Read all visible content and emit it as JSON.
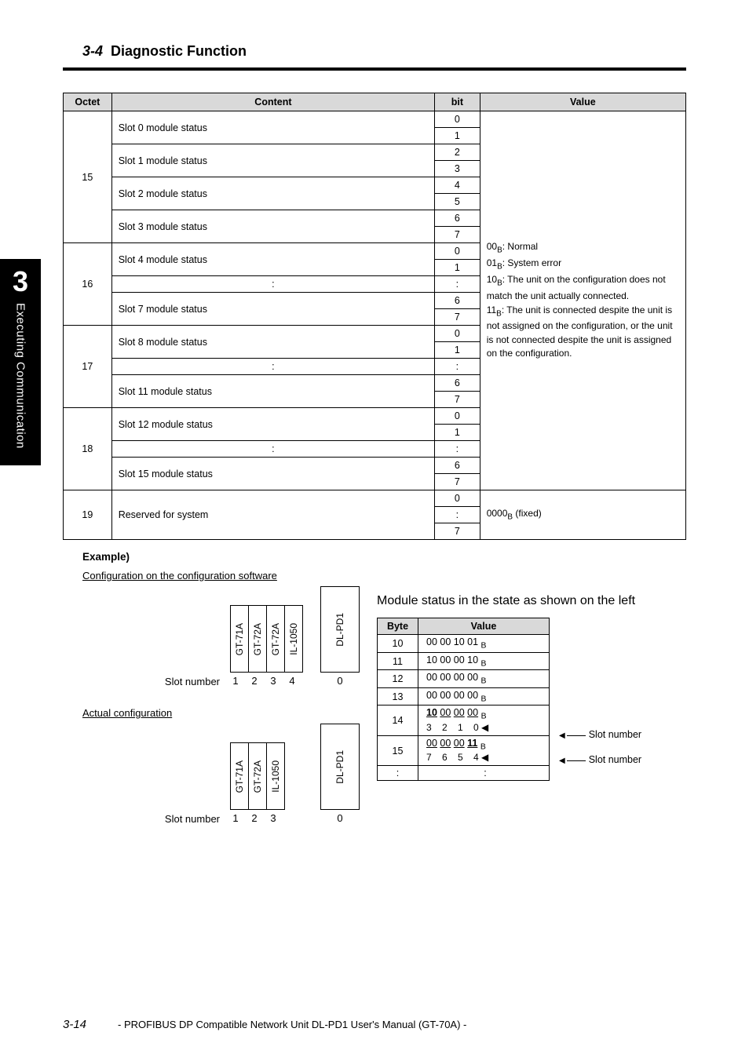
{
  "header": {
    "section_number": "3-4",
    "section_title": "Diagnostic Function"
  },
  "side_tab": {
    "chapter_num": "3",
    "chapter_text": "Executing Communication"
  },
  "table": {
    "headers": {
      "octet": "Octet",
      "content": "Content",
      "bit": "bit",
      "value": "Value"
    },
    "value_text": {
      "line1_code": "00",
      "line1_sub": "B",
      "line1_rest": ": Normal",
      "line2_code": "01",
      "line2_sub": "B",
      "line2_rest": ": System error",
      "line3_code": "10",
      "line3_sub": "B",
      "line3_rest": ": The unit on the configuration does not match the unit actually connected.",
      "line4_code": "11",
      "line4_sub": "B",
      "line4_rest": ": The unit is connected despite the unit is not assigned on the configuration, or the unit is not connected despite the unit is assigned on the configuration."
    },
    "octet19_value": {
      "code": "0000",
      "sub": "B",
      "rest": " (fixed)"
    },
    "rows": [
      {
        "octet": "15",
        "items": [
          {
            "content": "Slot 0 module status",
            "bits": [
              "0",
              "1"
            ]
          },
          {
            "content": "Slot 1 module status",
            "bits": [
              "2",
              "3"
            ]
          },
          {
            "content": "Slot 2 module status",
            "bits": [
              "4",
              "5"
            ]
          },
          {
            "content": "Slot 3 module status",
            "bits": [
              "6",
              "7"
            ]
          }
        ]
      },
      {
        "octet": "16",
        "items": [
          {
            "content": "Slot 4 module status",
            "bits": [
              "0",
              "1"
            ]
          },
          {
            "content": ":",
            "bits": [
              ":"
            ],
            "center": true
          },
          {
            "content": "Slot 7 module status",
            "bits": [
              "6",
              "7"
            ]
          }
        ]
      },
      {
        "octet": "17",
        "items": [
          {
            "content": "Slot 8 module status",
            "bits": [
              "0",
              "1"
            ]
          },
          {
            "content": ":",
            "bits": [
              ":"
            ],
            "center": true
          },
          {
            "content": "Slot 11 module status",
            "bits": [
              "6",
              "7"
            ]
          }
        ]
      },
      {
        "octet": "18",
        "items": [
          {
            "content": "Slot 12 module status",
            "bits": [
              "0",
              "1"
            ]
          },
          {
            "content": ":",
            "bits": [
              ":"
            ],
            "center": true
          },
          {
            "content": "Slot 15 module status",
            "bits": [
              "6",
              "7"
            ]
          }
        ]
      },
      {
        "octet": "19",
        "items": [
          {
            "content": "Reserved for system",
            "bits": [
              "0",
              ":",
              "7"
            ],
            "single": true
          }
        ]
      }
    ]
  },
  "example": {
    "label": "Example)",
    "config_label": "Configuration on the configuration software",
    "actual_label": "Actual configuration",
    "slot_number_label": "Slot number",
    "config_modules": [
      "GT-71A",
      "GT-72A",
      "GT-72A",
      "IL-1050",
      "",
      "DL-PD1"
    ],
    "config_slots": [
      "1",
      "2",
      "3",
      "4",
      "",
      "0"
    ],
    "actual_modules": [
      "GT-71A",
      "GT-72A",
      "IL-1050",
      "",
      "",
      "DL-PD1"
    ],
    "actual_slots": [
      "1",
      "2",
      "3",
      "",
      "",
      "0"
    ],
    "right_desc": "Module status in the state as shown on the left",
    "bytes_headers": {
      "byte": "Byte",
      "value": "Value"
    },
    "bytes_rows": [
      {
        "byte": "10",
        "value_html": "00 00 10 01 <sub>B</sub>"
      },
      {
        "byte": "11",
        "value_html": "10 00 00 10 <sub>B</sub>"
      },
      {
        "byte": "12",
        "value_html": "00 00 00 00 <sub>B</sub>"
      },
      {
        "byte": "13",
        "value_html": "00 00 00 00 <sub>B</sub>"
      },
      {
        "byte": "14",
        "value_html": "<span class='ul bd'>10</span> <span class='ul'>00</span> <span class='ul'>00</span> <span class='ul'>00</span> <sub>B</sub>",
        "row2": " 3&nbsp;&nbsp;&nbsp;&nbsp;2&nbsp;&nbsp;&nbsp;&nbsp;1&nbsp;&nbsp;&nbsp;&nbsp;0",
        "arrow": "Slot number"
      },
      {
        "byte": "15",
        "value_html": "<span class='ul'>00</span> <span class='ul'>00</span> <span class='ul'>00</span> <span class='ul bd'>11</span> <sub>B</sub>",
        "row2": " 7&nbsp;&nbsp;&nbsp;&nbsp;6&nbsp;&nbsp;&nbsp;&nbsp;5&nbsp;&nbsp;&nbsp;&nbsp;4",
        "arrow": "Slot number"
      },
      {
        "byte": ":",
        "value_html": ":"
      }
    ],
    "arrow_label": "Slot number"
  },
  "footer": {
    "page": "3-14",
    "text": "- PROFIBUS DP Compatible Network Unit DL-PD1 User's Manual (GT-70A) -"
  }
}
